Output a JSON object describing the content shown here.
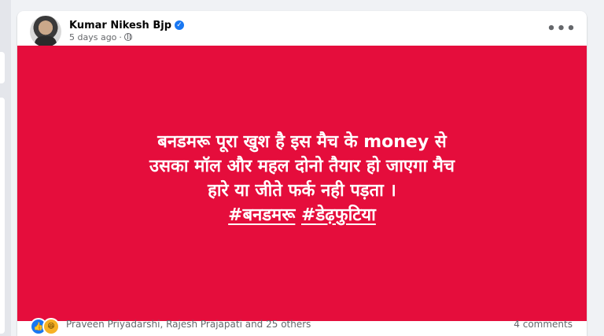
{
  "post": {
    "author": "Kumar Nikesh Bjp",
    "time": "5 days ago",
    "separator": "·",
    "more_label": "•••",
    "text_lines": [
      "बनडमरू पूरा खुश है इस मैच के money से",
      "उसका मॉल और महल दोनो तैयार हो जाएगा मैच",
      "हारे या जीते फर्क नही पड़ता ।"
    ],
    "hashtags": [
      "#बनडमरू",
      "#डेढ़फुटिया"
    ],
    "image_background": "#e50d3c",
    "reactions": {
      "icons": [
        "like-icon",
        "haha-icon"
      ],
      "summary": "Praveen Priyadarshi, Rajesh Prajapati and 25 others"
    },
    "comments": "4 comments"
  },
  "colors": {
    "page_bg": "#f0f2f5",
    "accent": "#1877f2",
    "muted_text": "#65676b"
  }
}
